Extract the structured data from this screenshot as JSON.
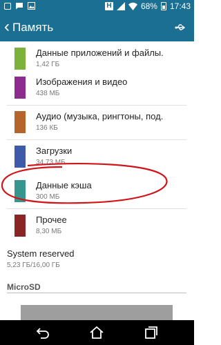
{
  "status_bar": {
    "battery_text": "68%",
    "time": "17:43",
    "icons": [
      "notification-box-icon",
      "chat-icon",
      "image-icon",
      "h-icon",
      "signal-icon",
      "wifi-icon",
      "battery-icon"
    ]
  },
  "toolbar": {
    "title": "Память",
    "back_icon": "chevron-left-icon",
    "right_icon": "usb-icon"
  },
  "storage_items": [
    {
      "label": "Данные приложений и файлы.",
      "size": "1,42 ГБ",
      "color": "#7cb23c"
    },
    {
      "label": "Изображения и видео",
      "size": "438 МБ",
      "color": "#8e2b8e"
    },
    {
      "label": "Аудио (музыка, рингтоны, под.",
      "size": "136 КБ",
      "color": "#b5652b"
    },
    {
      "label": "Загрузки",
      "size": "34,73 МБ",
      "color": "#3f5aa8"
    },
    {
      "label": "Данные кэша",
      "size": "300 МБ",
      "color": "#37958f"
    },
    {
      "label": "Прочее",
      "size": "8,30 МБ",
      "color": "#8a2525"
    }
  ],
  "system": {
    "label": "System reserved",
    "size": "5,23 ГБ/16,00 ГБ"
  },
  "section": {
    "title": "MicroSD"
  },
  "highlight_color": "#d0141a",
  "nav": {
    "icons": [
      "back-icon",
      "home-icon",
      "recent-apps-icon"
    ]
  }
}
